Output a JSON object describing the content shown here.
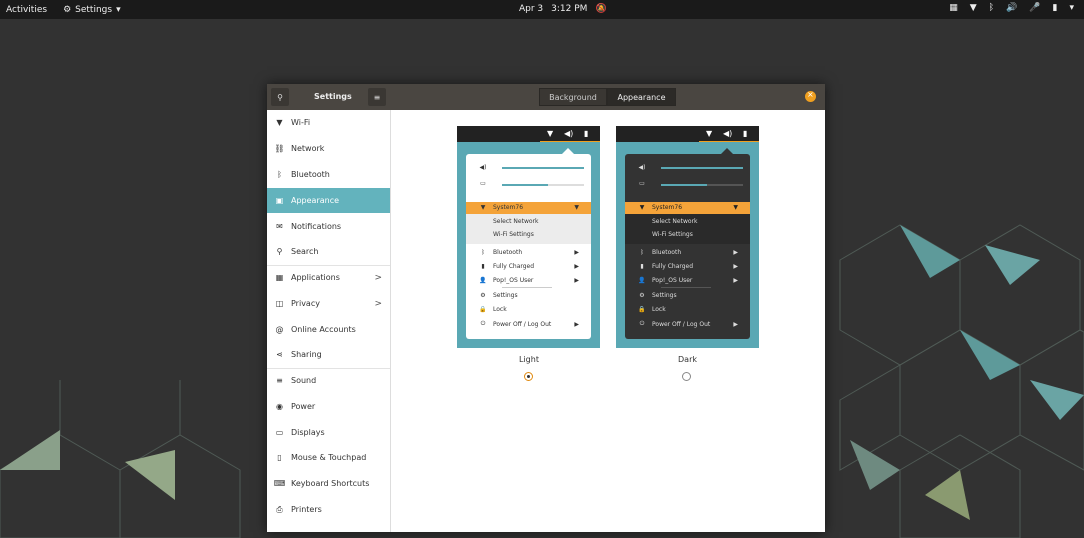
{
  "topbar": {
    "activities": "Activities",
    "app_menu": "Settings",
    "date": "Apr 3",
    "time": "3:12 PM"
  },
  "window": {
    "title": "Settings",
    "tabs": [
      "Background",
      "Appearance"
    ],
    "active_tab": "Appearance",
    "accent": "#63b3bd",
    "close_color": "#f0a020"
  },
  "sidebar": {
    "items": [
      {
        "label": "Wi-Fi",
        "icon": "wifi-icon"
      },
      {
        "label": "Network",
        "icon": "network-icon"
      },
      {
        "label": "Bluetooth",
        "icon": "bluetooth-icon"
      },
      {
        "label": "Appearance",
        "icon": "appearance-icon",
        "selected": true
      },
      {
        "label": "Notifications",
        "icon": "notifications-icon"
      },
      {
        "label": "Search",
        "icon": "search-icon"
      },
      {
        "label": "Applications",
        "icon": "applications-icon",
        "chevron": ">"
      },
      {
        "label": "Privacy",
        "icon": "privacy-icon",
        "chevron": ">"
      },
      {
        "label": "Online Accounts",
        "icon": "online-accounts-icon"
      },
      {
        "label": "Sharing",
        "icon": "sharing-icon"
      },
      {
        "label": "Sound",
        "icon": "sound-icon"
      },
      {
        "label": "Power",
        "icon": "power-icon"
      },
      {
        "label": "Displays",
        "icon": "displays-icon"
      },
      {
        "label": "Mouse & Touchpad",
        "icon": "mouse-icon"
      },
      {
        "label": "Keyboard Shortcuts",
        "icon": "keyboard-icon"
      },
      {
        "label": "Printers",
        "icon": "printer-icon"
      }
    ]
  },
  "previews": {
    "light": {
      "caption": "Light",
      "selected": true,
      "network": "System76",
      "select_network": "Select Network",
      "wifi_settings": "Wi-Fi Settings",
      "bluetooth": "Bluetooth",
      "battery": "Fully Charged",
      "user": "Pop!_OS User",
      "settings": "Settings",
      "lock": "Lock",
      "power": "Power Off / Log Out"
    },
    "dark": {
      "caption": "Dark",
      "selected": false,
      "network": "System76",
      "select_network": "Select Network",
      "wifi_settings": "Wi-Fi Settings",
      "bluetooth": "Bluetooth",
      "battery": "Fully Charged",
      "user": "Pop!_OS User",
      "settings": "Settings",
      "lock": "Lock",
      "power": "Power Off / Log Out"
    }
  }
}
